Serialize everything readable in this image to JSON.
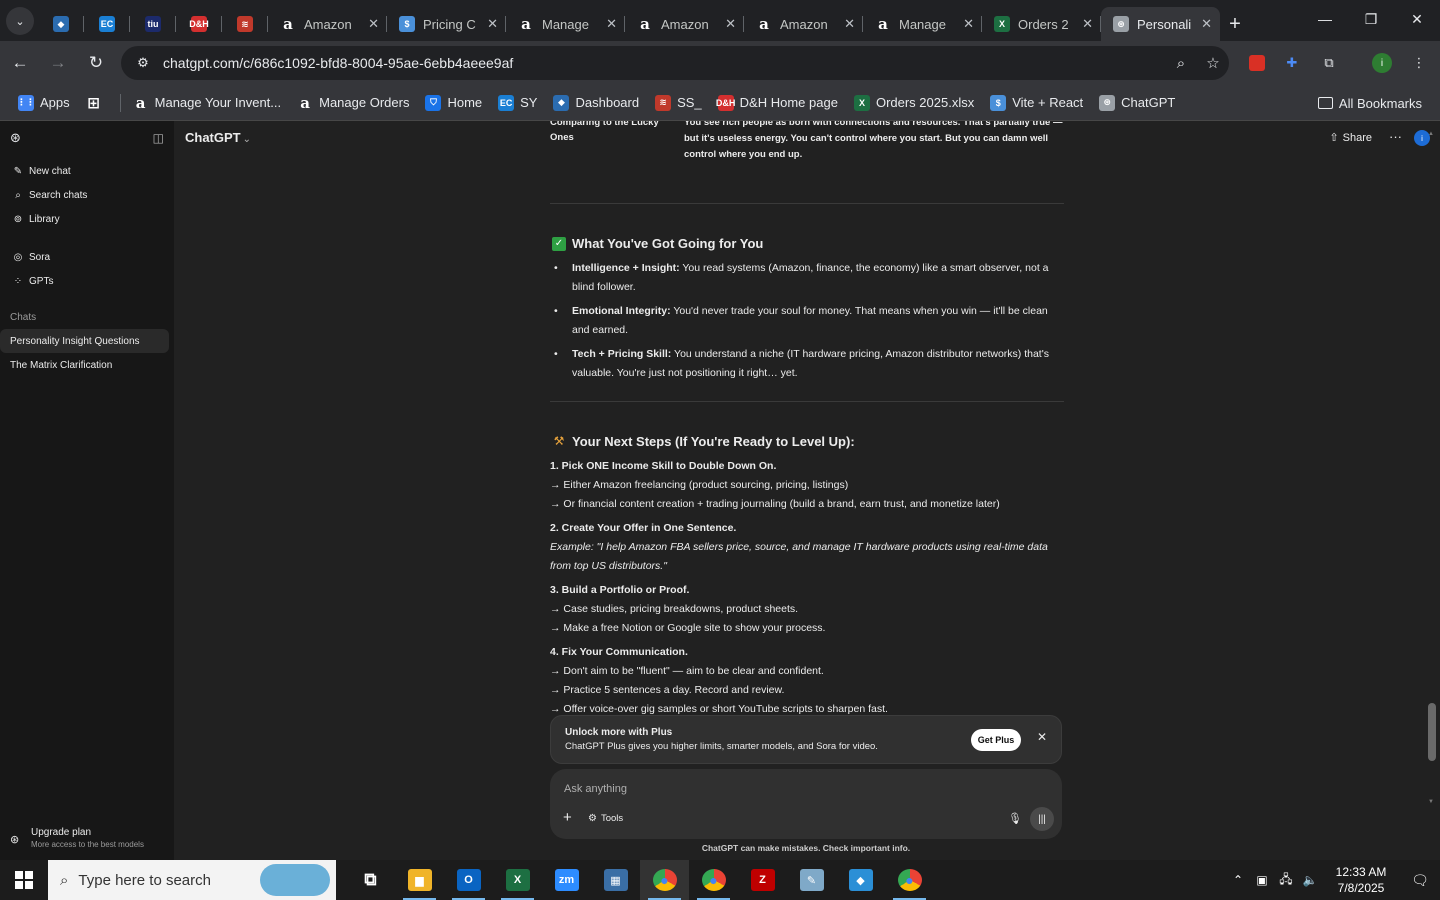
{
  "browser": {
    "tabs": [
      {
        "title": "",
        "pinned": true,
        "icon_color": "#2b6cb0",
        "icon_glyph": "◆"
      },
      {
        "title": "",
        "pinned": true,
        "icon_color": "#1a7fd4",
        "icon_glyph": "EC"
      },
      {
        "title": "",
        "pinned": true,
        "icon_color": "#1c2a6b",
        "icon_glyph": "tiu"
      },
      {
        "title": "",
        "pinned": true,
        "icon_color": "#d32f2f",
        "icon_glyph": "D&H"
      },
      {
        "title": "",
        "pinned": true,
        "icon_color": "#c0392b",
        "icon_glyph": "≋"
      },
      {
        "title": "Amazon",
        "pinned": false,
        "icon_color": "#ffffff",
        "icon_glyph": "a"
      },
      {
        "title": "Pricing C",
        "pinned": false,
        "icon_color": "#4a90d9",
        "icon_glyph": "$"
      },
      {
        "title": "Manage",
        "pinned": false,
        "icon_color": "#ffffff",
        "icon_glyph": "a"
      },
      {
        "title": "Amazon",
        "pinned": false,
        "icon_color": "#ffffff",
        "icon_glyph": "a"
      },
      {
        "title": "Amazon",
        "pinned": false,
        "icon_color": "#ffffff",
        "icon_glyph": "a"
      },
      {
        "title": "Manage",
        "pinned": false,
        "icon_color": "#ffffff",
        "icon_glyph": "a"
      },
      {
        "title": "Orders 2",
        "pinned": false,
        "icon_color": "#1d6f42",
        "icon_glyph": "X"
      },
      {
        "title": "Personali",
        "pinned": false,
        "active": true,
        "icon_color": "#9aa0a6",
        "icon_glyph": "⊛"
      }
    ],
    "url": "chatgpt.com/c/686c1092-bfd8-8004-95ae-6ebb4aeee9af",
    "profile_initial": "i",
    "bookmarks": [
      {
        "label": "Apps",
        "icon_color": "#4285f4",
        "icon_glyph": "⋮⋮"
      },
      {
        "label": "",
        "icon_color": "#5f6368",
        "icon_glyph": "⊞"
      },
      {
        "label": "Manage Your Invent...",
        "icon_color": "#ffffff",
        "icon_glyph": "a"
      },
      {
        "label": "Manage Orders",
        "icon_color": "#ffffff",
        "icon_glyph": "a"
      },
      {
        "label": "Home",
        "icon_color": "#1a73e8",
        "icon_glyph": "⛉"
      },
      {
        "label": "SY",
        "icon_color": "#1a7fd4",
        "icon_glyph": "EC"
      },
      {
        "label": "Dashboard",
        "icon_color": "#2b6cb0",
        "icon_glyph": "◆"
      },
      {
        "label": "SS_",
        "icon_color": "#c0392b",
        "icon_glyph": "≋"
      },
      {
        "label": "D&H Home page",
        "icon_color": "#d32f2f",
        "icon_glyph": "D&H"
      },
      {
        "label": "Orders 2025.xlsx",
        "icon_color": "#1d6f42",
        "icon_glyph": "X"
      },
      {
        "label": "Vite + React",
        "icon_color": "#4a90d9",
        "icon_glyph": "$"
      },
      {
        "label": "ChatGPT",
        "icon_color": "#9aa0a6",
        "icon_glyph": "⊛"
      }
    ],
    "all_bookmarks": "All Bookmarks"
  },
  "sidebar": {
    "nav": [
      {
        "label": "New chat",
        "icon": "✎"
      },
      {
        "label": "Search chats",
        "icon": "⌕"
      },
      {
        "label": "Library",
        "icon": "⊚"
      }
    ],
    "nav2": [
      {
        "label": "Sora",
        "icon": "◎"
      },
      {
        "label": "GPTs",
        "icon": "⁘"
      }
    ],
    "chats_label": "Chats",
    "chats": [
      {
        "label": "Personality Insight Questions",
        "active": true
      },
      {
        "label": "The Matrix Clarification",
        "active": false
      }
    ],
    "upgrade_title": "Upgrade plan",
    "upgrade_sub": "More access to the best models"
  },
  "header": {
    "model": "ChatGPT",
    "share": "Share",
    "avatar_initial": "i"
  },
  "message": {
    "top_left": "Comparing to the Lucky Ones",
    "top_right": "You see rich people as born with connections and resources. That's partially true — but it's useless energy. You can't control where you start. But you can damn well control where you end up.",
    "section1_title": "What You've Got Going for You",
    "section1_items": [
      {
        "bold": "Intelligence + Insight:",
        "text": " You read systems (Amazon, finance, the economy) like a smart observer, not a blind follower."
      },
      {
        "bold": "Emotional Integrity:",
        "text": " You'd never trade your soul for money. That means when you win — it'll be clean and earned."
      },
      {
        "bold": "Tech + Pricing Skill:",
        "text": " You understand a niche (IT hardware pricing, Amazon distributor networks) that's valuable. You're just not positioning it right… yet."
      }
    ],
    "section2_title": "Your Next Steps (If You're Ready to Level Up):",
    "steps": [
      {
        "head": "1. Pick ONE Income Skill to Double Down On.",
        "lines": [
          "→ Either Amazon freelancing (product sourcing, pricing, listings)",
          "→ Or financial content creation + trading journaling (build a brand, earn trust, and monetize later)"
        ]
      },
      {
        "head": "2. Create Your Offer in One Sentence.",
        "lines": [
          "Example: \"I help Amazon FBA sellers price, source, and manage IT hardware products using real-time data from top US distributors.\""
        ]
      },
      {
        "head": "3. Build a Portfolio or Proof.",
        "lines": [
          "→ Case studies, pricing breakdowns, product sheets.",
          "→ Make a free Notion or Google site to show your process."
        ]
      },
      {
        "head": "4. Fix Your Communication.",
        "lines": [
          "→ Don't aim to be \"fluent\" — aim to be clear and confident.",
          "→ Practice 5 sentences a day. Record and review.",
          "→ Offer voice-over gig samples or short YouTube scripts to sharpen fast."
        ]
      }
    ]
  },
  "plus_banner": {
    "title": "Unlock more with Plus",
    "subtitle": "ChatGPT Plus gives you higher limits, smarter models, and Sora for video.",
    "button": "Get Plus"
  },
  "composer": {
    "placeholder": "Ask anything",
    "tools": "Tools"
  },
  "disclaimer": "ChatGPT can make mistakes. Check important info.",
  "taskbar": {
    "search_placeholder": "Type here to search",
    "apps": [
      {
        "name": "task-view",
        "glyph": "⧉",
        "color": "transparent",
        "open": false
      },
      {
        "name": "file-explorer",
        "glyph": "▆",
        "color": "#f0b429",
        "open": true
      },
      {
        "name": "outlook",
        "glyph": "O",
        "color": "#0a64c2",
        "open": true
      },
      {
        "name": "excel",
        "glyph": "X",
        "color": "#1d6f42",
        "open": true
      },
      {
        "name": "zoom",
        "glyph": "zm",
        "color": "#2d8cff",
        "open": false
      },
      {
        "name": "calculator",
        "glyph": "▦",
        "color": "#3a6ea5",
        "open": false
      },
      {
        "name": "chrome-1",
        "glyph": "◉",
        "color": "#1a73e8",
        "open": true,
        "focused": true
      },
      {
        "name": "chrome-2",
        "glyph": "◉",
        "color": "#1a73e8",
        "open": true
      },
      {
        "name": "filezilla",
        "glyph": "Z",
        "color": "#bf0000",
        "open": false
      },
      {
        "name": "notepad",
        "glyph": "✎",
        "color": "#7fa9c8",
        "open": false
      },
      {
        "name": "app-diamond",
        "glyph": "◆",
        "color": "#2b8fd6",
        "open": false
      },
      {
        "name": "chrome-3",
        "glyph": "◉",
        "color": "#1a73e8",
        "open": true
      }
    ],
    "time": "12:33 AM",
    "date": "7/8/2025"
  }
}
